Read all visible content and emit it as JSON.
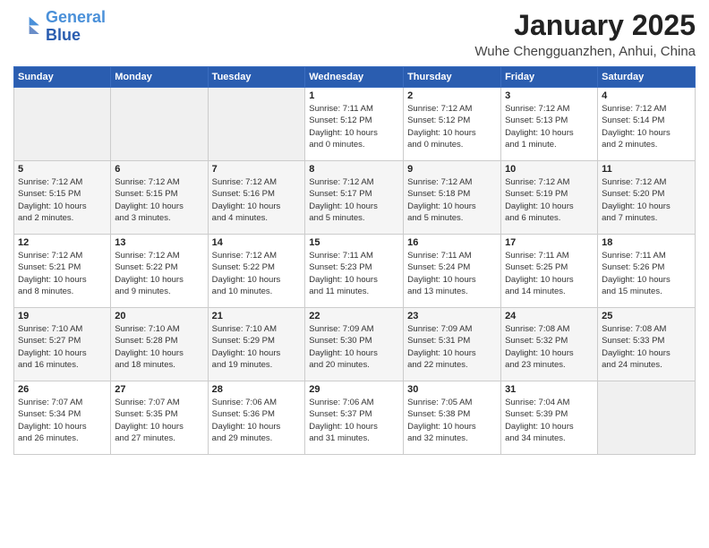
{
  "header": {
    "logo_line1": "General",
    "logo_line2": "Blue",
    "month": "January 2025",
    "location": "Wuhe Chengguanzhen, Anhui, China"
  },
  "weekdays": [
    "Sunday",
    "Monday",
    "Tuesday",
    "Wednesday",
    "Thursday",
    "Friday",
    "Saturday"
  ],
  "weeks": [
    [
      {
        "day": "",
        "info": ""
      },
      {
        "day": "",
        "info": ""
      },
      {
        "day": "",
        "info": ""
      },
      {
        "day": "1",
        "info": "Sunrise: 7:11 AM\nSunset: 5:12 PM\nDaylight: 10 hours\nand 0 minutes."
      },
      {
        "day": "2",
        "info": "Sunrise: 7:12 AM\nSunset: 5:12 PM\nDaylight: 10 hours\nand 0 minutes."
      },
      {
        "day": "3",
        "info": "Sunrise: 7:12 AM\nSunset: 5:13 PM\nDaylight: 10 hours\nand 1 minute."
      },
      {
        "day": "4",
        "info": "Sunrise: 7:12 AM\nSunset: 5:14 PM\nDaylight: 10 hours\nand 2 minutes."
      }
    ],
    [
      {
        "day": "5",
        "info": "Sunrise: 7:12 AM\nSunset: 5:15 PM\nDaylight: 10 hours\nand 2 minutes."
      },
      {
        "day": "6",
        "info": "Sunrise: 7:12 AM\nSunset: 5:15 PM\nDaylight: 10 hours\nand 3 minutes."
      },
      {
        "day": "7",
        "info": "Sunrise: 7:12 AM\nSunset: 5:16 PM\nDaylight: 10 hours\nand 4 minutes."
      },
      {
        "day": "8",
        "info": "Sunrise: 7:12 AM\nSunset: 5:17 PM\nDaylight: 10 hours\nand 5 minutes."
      },
      {
        "day": "9",
        "info": "Sunrise: 7:12 AM\nSunset: 5:18 PM\nDaylight: 10 hours\nand 5 minutes."
      },
      {
        "day": "10",
        "info": "Sunrise: 7:12 AM\nSunset: 5:19 PM\nDaylight: 10 hours\nand 6 minutes."
      },
      {
        "day": "11",
        "info": "Sunrise: 7:12 AM\nSunset: 5:20 PM\nDaylight: 10 hours\nand 7 minutes."
      }
    ],
    [
      {
        "day": "12",
        "info": "Sunrise: 7:12 AM\nSunset: 5:21 PM\nDaylight: 10 hours\nand 8 minutes."
      },
      {
        "day": "13",
        "info": "Sunrise: 7:12 AM\nSunset: 5:22 PM\nDaylight: 10 hours\nand 9 minutes."
      },
      {
        "day": "14",
        "info": "Sunrise: 7:12 AM\nSunset: 5:22 PM\nDaylight: 10 hours\nand 10 minutes."
      },
      {
        "day": "15",
        "info": "Sunrise: 7:11 AM\nSunset: 5:23 PM\nDaylight: 10 hours\nand 11 minutes."
      },
      {
        "day": "16",
        "info": "Sunrise: 7:11 AM\nSunset: 5:24 PM\nDaylight: 10 hours\nand 13 minutes."
      },
      {
        "day": "17",
        "info": "Sunrise: 7:11 AM\nSunset: 5:25 PM\nDaylight: 10 hours\nand 14 minutes."
      },
      {
        "day": "18",
        "info": "Sunrise: 7:11 AM\nSunset: 5:26 PM\nDaylight: 10 hours\nand 15 minutes."
      }
    ],
    [
      {
        "day": "19",
        "info": "Sunrise: 7:10 AM\nSunset: 5:27 PM\nDaylight: 10 hours\nand 16 minutes."
      },
      {
        "day": "20",
        "info": "Sunrise: 7:10 AM\nSunset: 5:28 PM\nDaylight: 10 hours\nand 18 minutes."
      },
      {
        "day": "21",
        "info": "Sunrise: 7:10 AM\nSunset: 5:29 PM\nDaylight: 10 hours\nand 19 minutes."
      },
      {
        "day": "22",
        "info": "Sunrise: 7:09 AM\nSunset: 5:30 PM\nDaylight: 10 hours\nand 20 minutes."
      },
      {
        "day": "23",
        "info": "Sunrise: 7:09 AM\nSunset: 5:31 PM\nDaylight: 10 hours\nand 22 minutes."
      },
      {
        "day": "24",
        "info": "Sunrise: 7:08 AM\nSunset: 5:32 PM\nDaylight: 10 hours\nand 23 minutes."
      },
      {
        "day": "25",
        "info": "Sunrise: 7:08 AM\nSunset: 5:33 PM\nDaylight: 10 hours\nand 24 minutes."
      }
    ],
    [
      {
        "day": "26",
        "info": "Sunrise: 7:07 AM\nSunset: 5:34 PM\nDaylight: 10 hours\nand 26 minutes."
      },
      {
        "day": "27",
        "info": "Sunrise: 7:07 AM\nSunset: 5:35 PM\nDaylight: 10 hours\nand 27 minutes."
      },
      {
        "day": "28",
        "info": "Sunrise: 7:06 AM\nSunset: 5:36 PM\nDaylight: 10 hours\nand 29 minutes."
      },
      {
        "day": "29",
        "info": "Sunrise: 7:06 AM\nSunset: 5:37 PM\nDaylight: 10 hours\nand 31 minutes."
      },
      {
        "day": "30",
        "info": "Sunrise: 7:05 AM\nSunset: 5:38 PM\nDaylight: 10 hours\nand 32 minutes."
      },
      {
        "day": "31",
        "info": "Sunrise: 7:04 AM\nSunset: 5:39 PM\nDaylight: 10 hours\nand 34 minutes."
      },
      {
        "day": "",
        "info": ""
      }
    ]
  ]
}
